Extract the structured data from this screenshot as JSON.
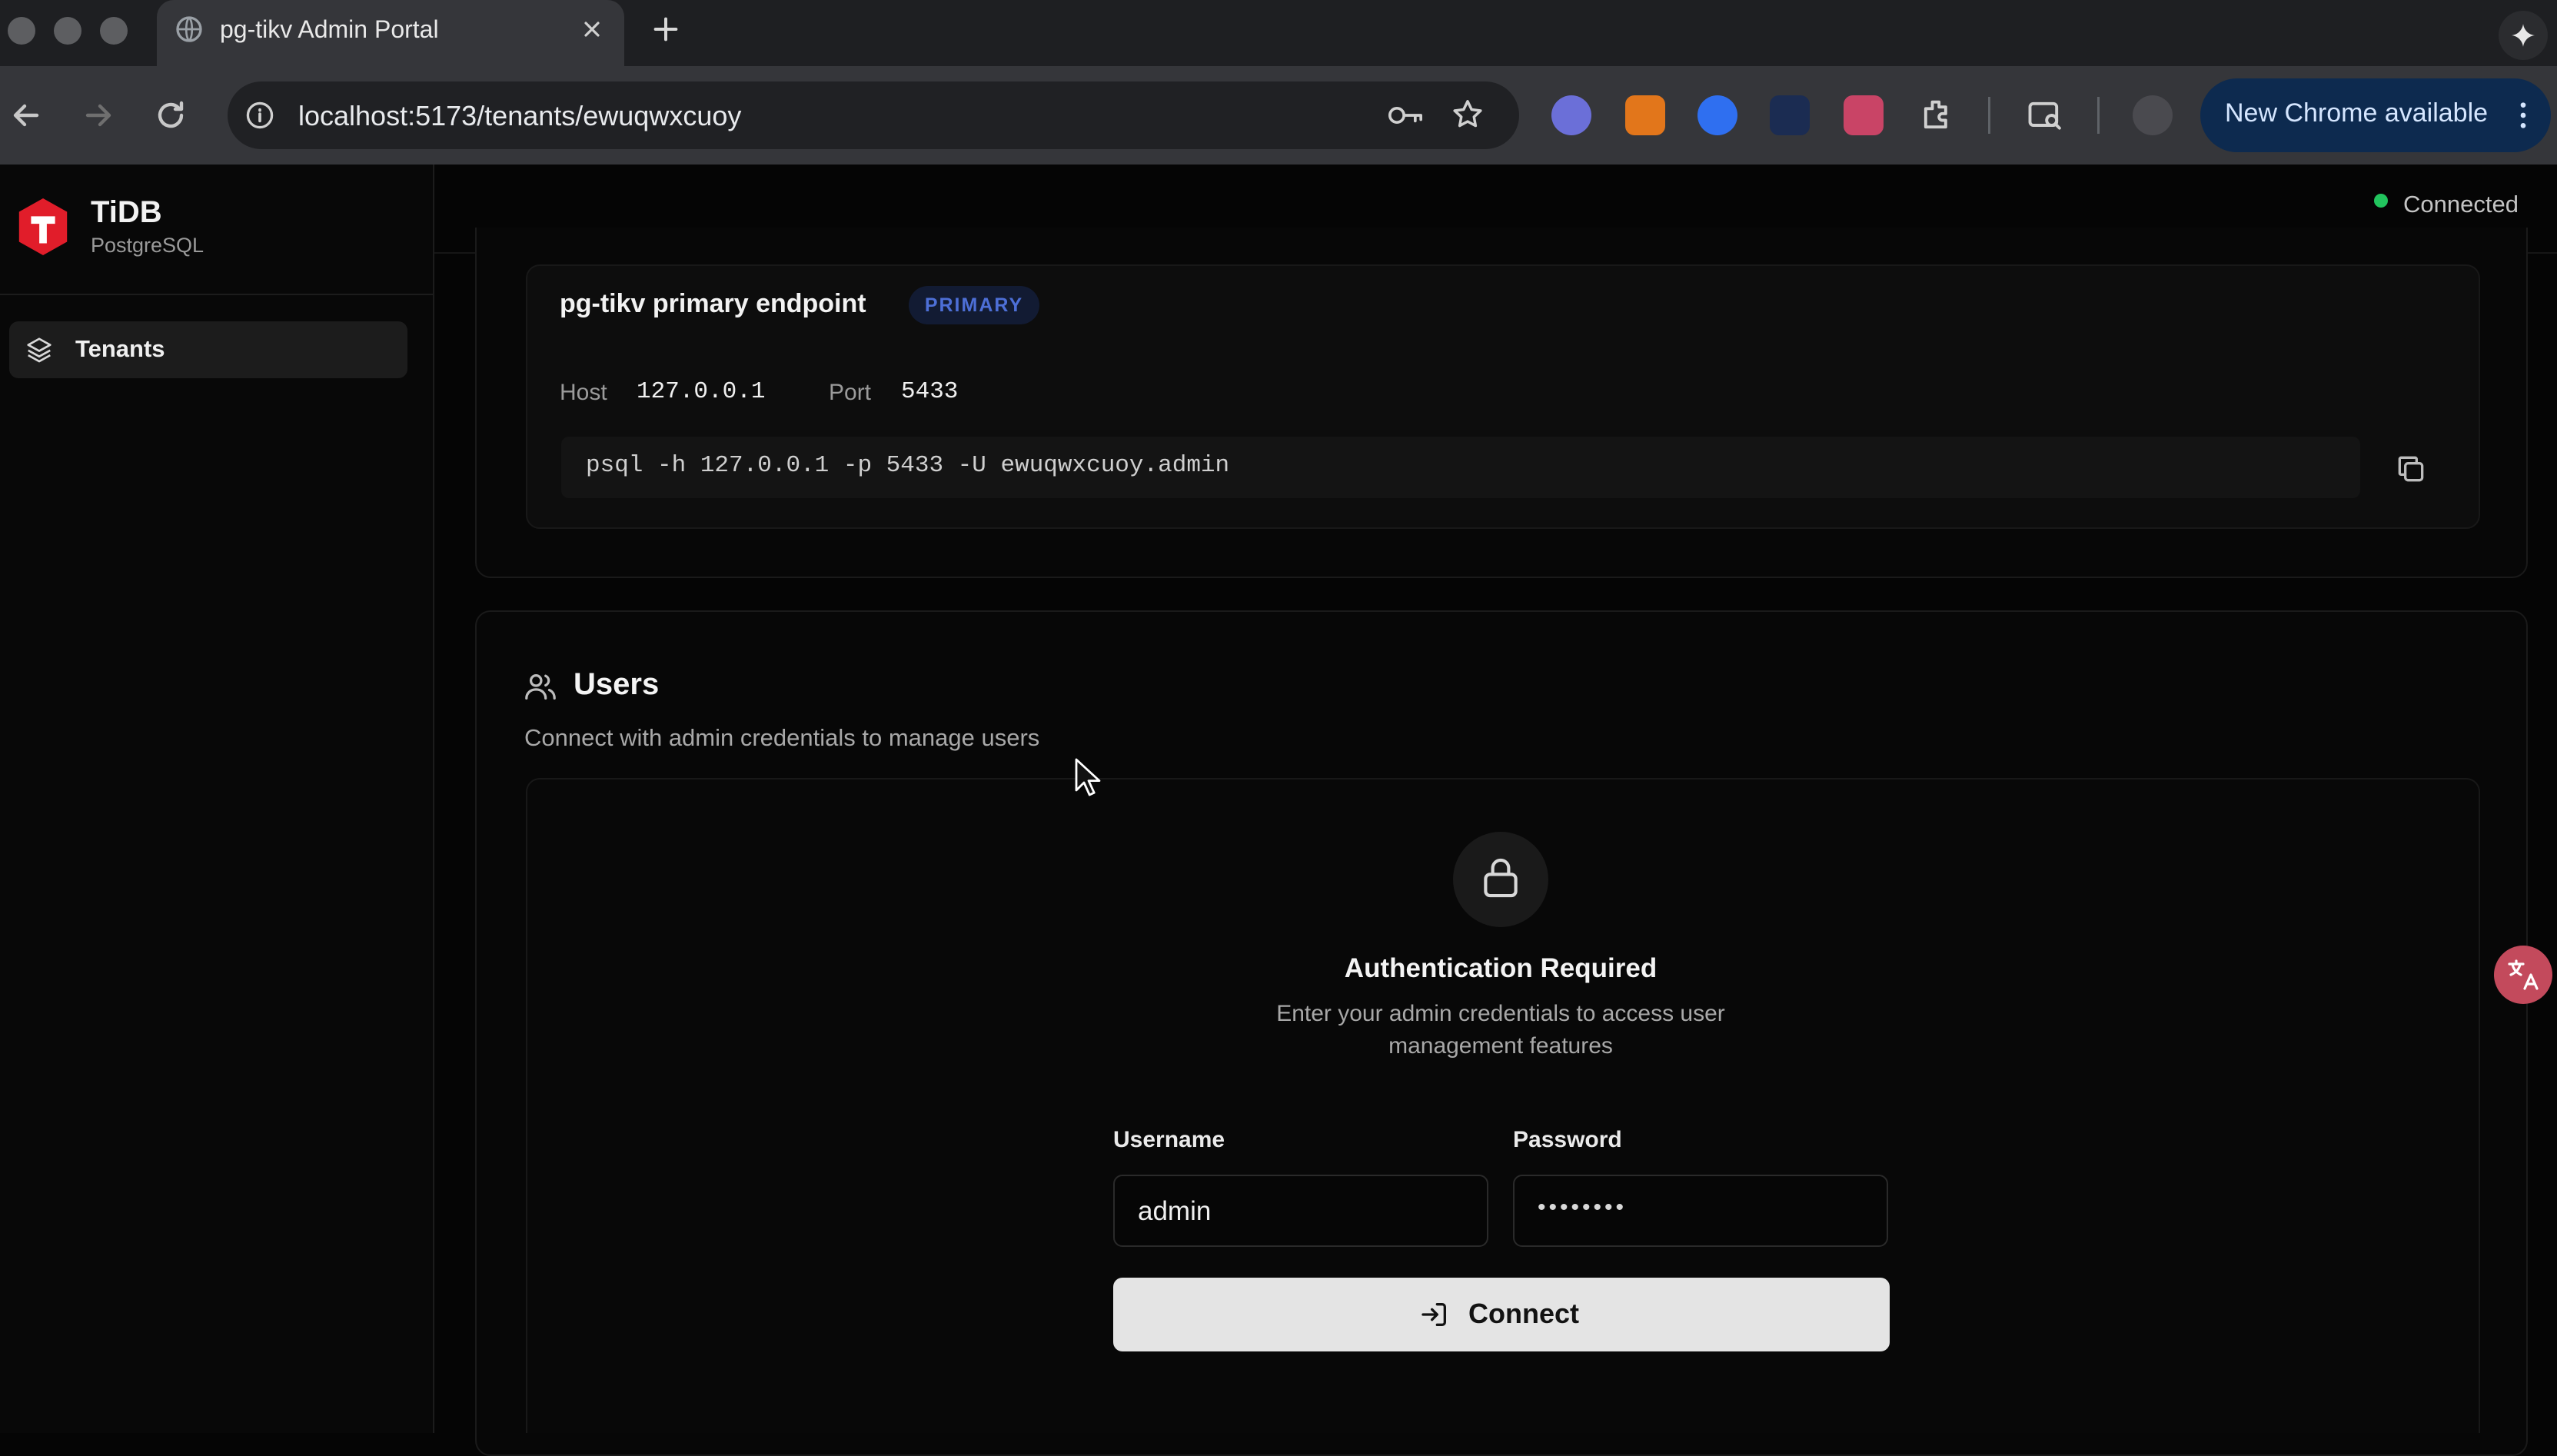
{
  "browser": {
    "tab_title": "pg-tikv Admin Portal",
    "url": "localhost:5173/tenants/ewuqwxcuoy",
    "update_button_label": "New Chrome available"
  },
  "sidebar": {
    "brand_name": "TiDB",
    "brand_subtitle": "PostgreSQL",
    "items": [
      {
        "label": "Tenants",
        "icon": "layers-icon"
      }
    ]
  },
  "header": {
    "status_text": "Connected",
    "status_color": "#22c55e"
  },
  "endpoint": {
    "title": "pg-tikv primary endpoint",
    "badge": "PRIMARY",
    "host_label": "Host",
    "host_value": "127.0.0.1",
    "port_label": "Port",
    "port_value": "5433",
    "command": "psql -h 127.0.0.1 -p 5433 -U ewuqwxcuoy.admin"
  },
  "users": {
    "title": "Users",
    "subtitle": "Connect with admin credentials to manage users",
    "auth": {
      "title": "Authentication Required",
      "description_line1": "Enter your admin credentials to access user",
      "description_line2": "management features",
      "username_label": "Username",
      "username_value": "admin",
      "password_label": "Password",
      "password_value": "••••••••",
      "connect_label": "Connect"
    }
  },
  "colors": {
    "accent_brand": "#e11d2a",
    "badge_text": "#4d6fd6"
  }
}
